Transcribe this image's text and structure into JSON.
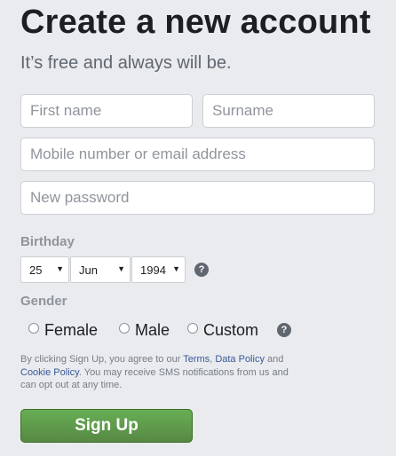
{
  "header": {
    "title": "Create a new account",
    "subtitle": "It’s free and always will be."
  },
  "form": {
    "first_name_placeholder": "First name",
    "surname_placeholder": "Surname",
    "contact_placeholder": "Mobile number or email address",
    "password_placeholder": "New password"
  },
  "birthday": {
    "label": "Birthday",
    "day": "25",
    "month": "Jun",
    "year": "1994",
    "help": "?"
  },
  "gender": {
    "label": "Gender",
    "options": [
      "Female",
      "Male",
      "Custom"
    ],
    "help": "?"
  },
  "terms": {
    "text_1": "By clicking Sign Up, you agree to our ",
    "link_terms": "Terms",
    "text_2": ", ",
    "link_data_policy": "Data Policy",
    "text_3": " and ",
    "link_cookie_policy": "Cookie Policy",
    "text_4": ". You may receive SMS notifications from us and can opt out at any time."
  },
  "signup_button": "Sign Up",
  "colors": {
    "accent_green": "#69a74e",
    "link_blue": "#385898",
    "background": "#e9ebee"
  }
}
